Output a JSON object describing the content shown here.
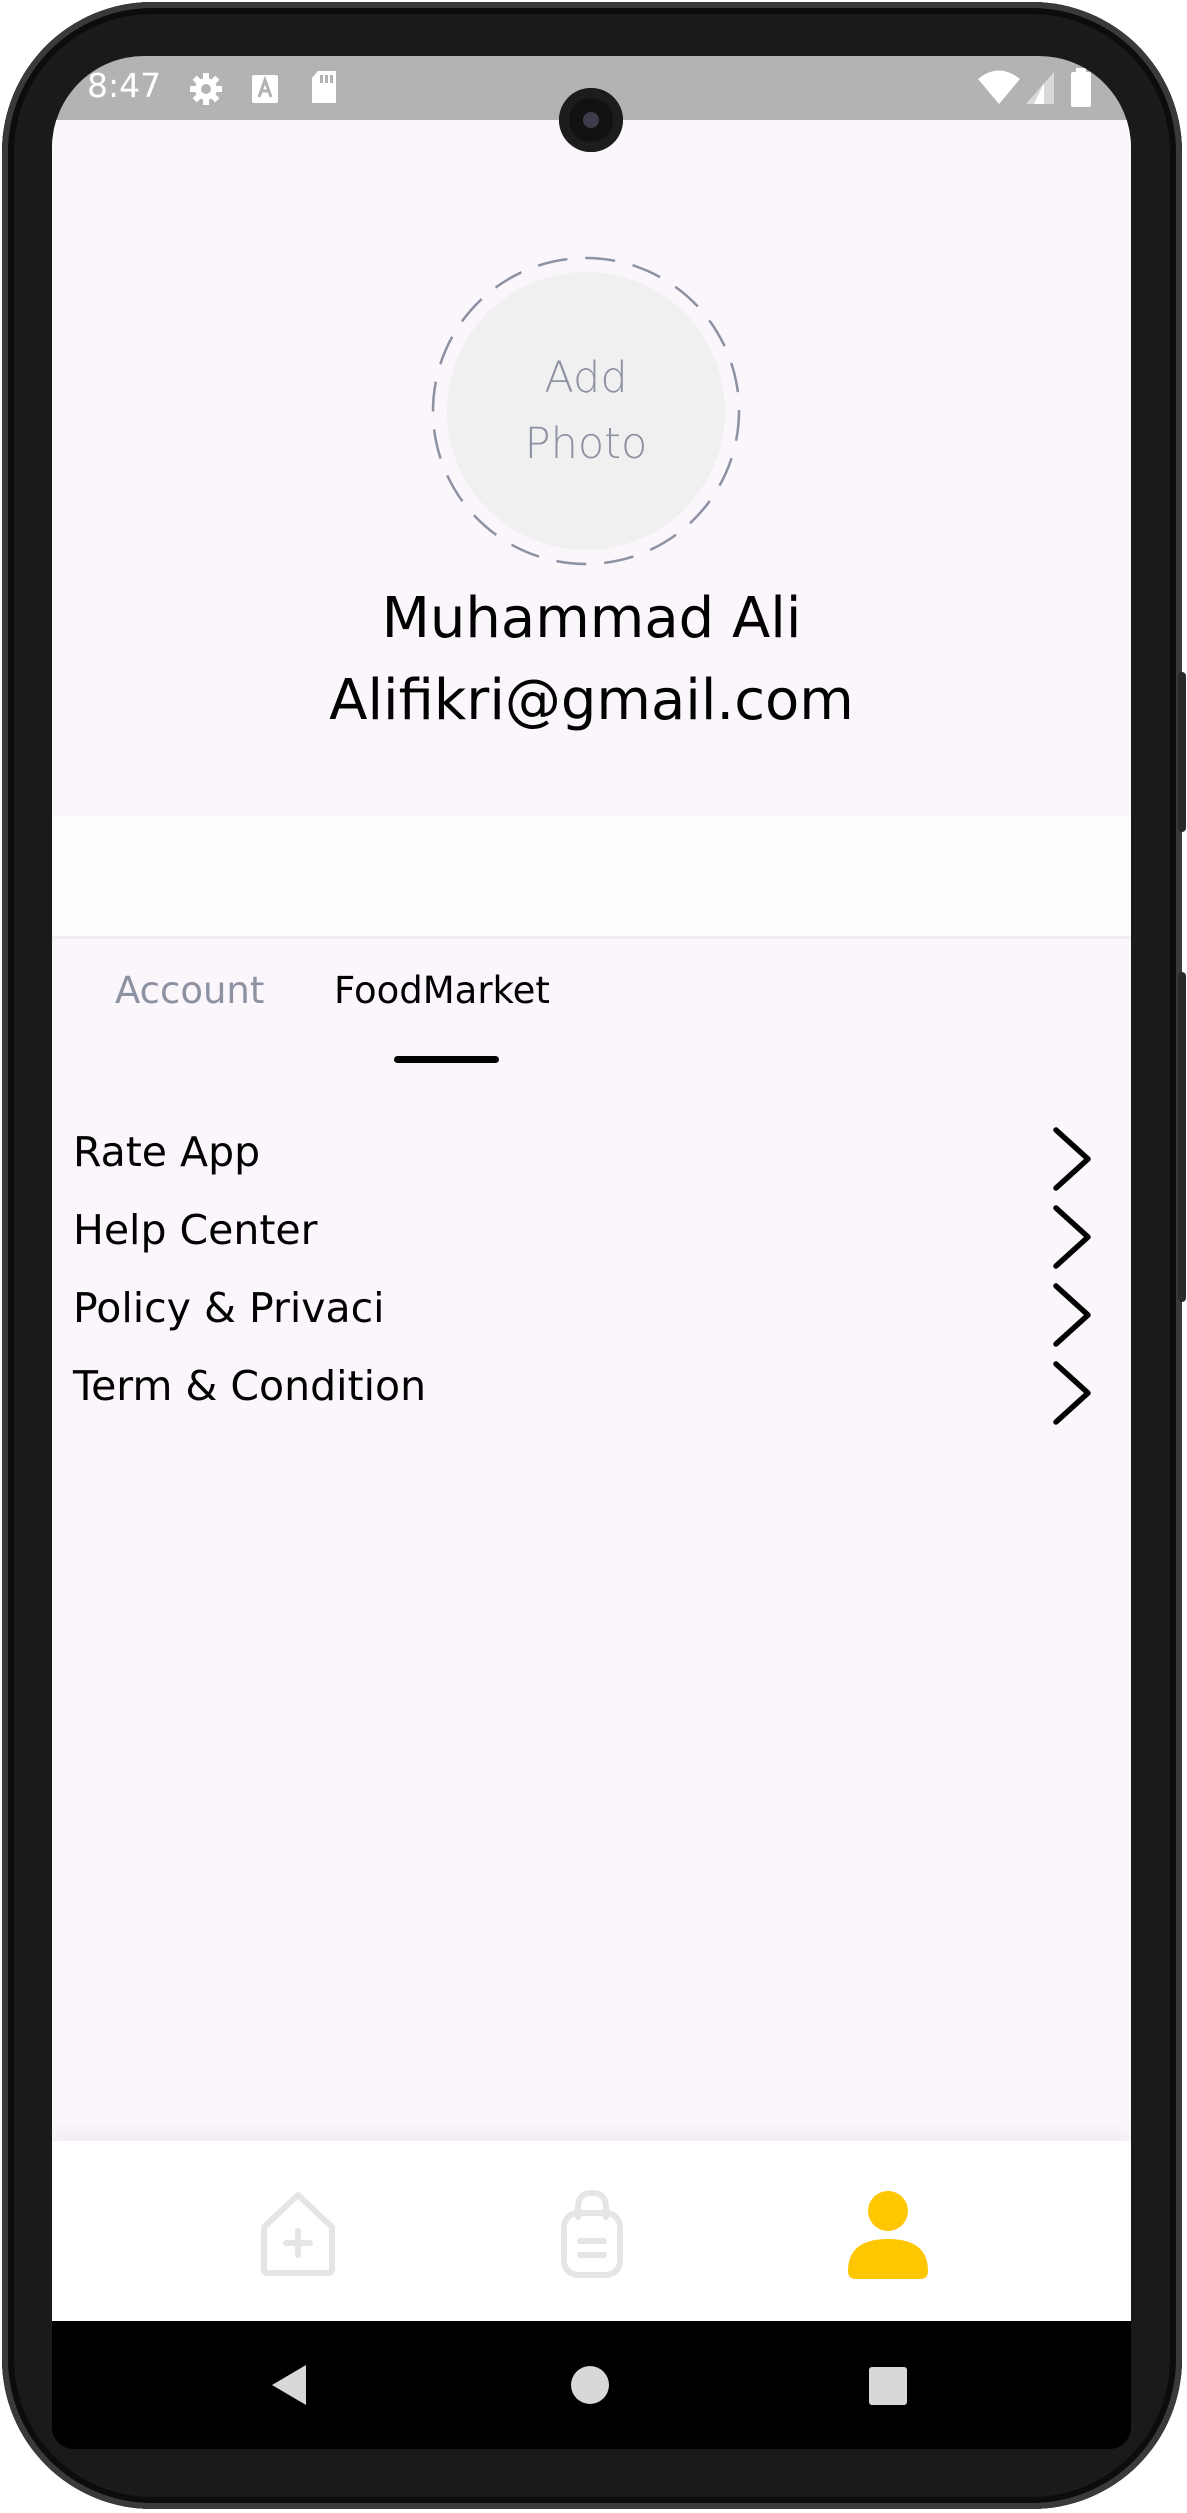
{
  "status_bar": {
    "time": "8:47",
    "icons": [
      "gear-icon",
      "a-icon",
      "sdcard-icon",
      "wifi-icon",
      "signal-icon",
      "battery-icon"
    ]
  },
  "profile": {
    "photo_placeholder_line1": "Add",
    "photo_placeholder_line2": "Photo",
    "name": "Muhammad Ali",
    "email": "Alifikri@gmail.com"
  },
  "tabs": [
    {
      "label": "Account",
      "active": false
    },
    {
      "label": "FoodMarket",
      "active": true
    }
  ],
  "menu": [
    {
      "label": "Rate App"
    },
    {
      "label": "Help Center"
    },
    {
      "label": "Policy & Privaci"
    },
    {
      "label": "Term & Condition"
    }
  ],
  "bottom_nav": [
    {
      "icon": "home-icon",
      "active": false
    },
    {
      "icon": "order-bag-icon",
      "active": false
    },
    {
      "icon": "profile-icon",
      "active": true
    }
  ],
  "colors": {
    "accent": "#FFC700",
    "inactive_icon": "#E5E5E5",
    "muted_text": "#8D92A3",
    "page_bg": "#FBF5FC"
  }
}
